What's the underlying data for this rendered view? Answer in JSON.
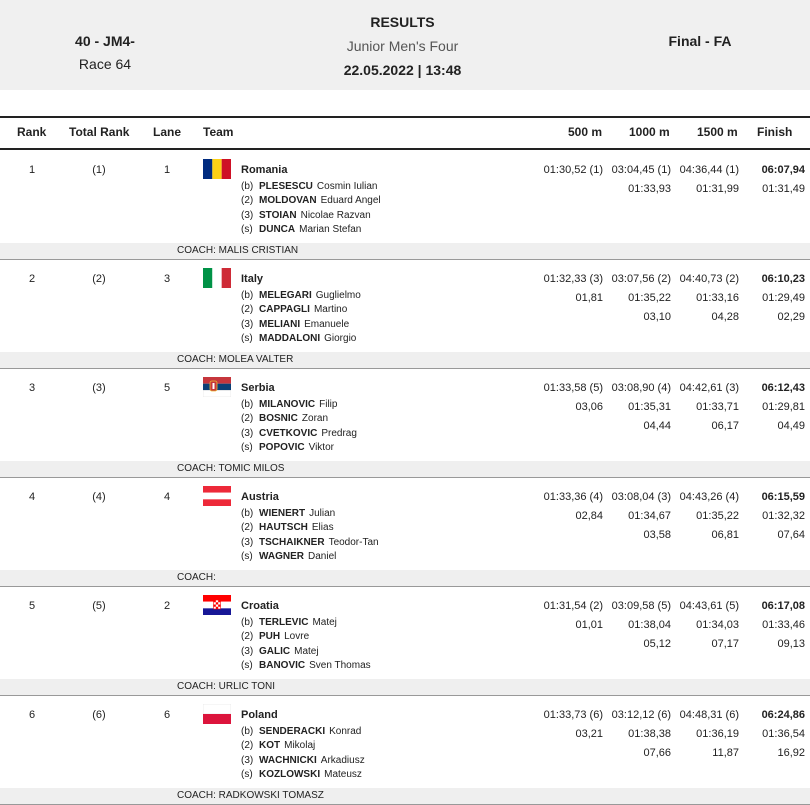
{
  "header": {
    "event_code": "40 - JM4-",
    "race": "Race 64",
    "title": "RESULTS",
    "event_name": "Junior Men's Four",
    "datetime": "22.05.2022 | 13:48",
    "final": "Final - FA"
  },
  "columns": [
    "Rank",
    "Total Rank",
    "Lane",
    "Team",
    "500 m",
    "1000 m",
    "1500 m",
    "Finish"
  ],
  "rows": [
    {
      "rank": "1",
      "trank": "(1)",
      "lane": "1",
      "country": "Romania",
      "flag": "romania-flag",
      "crew": [
        {
          "pos": "(b)",
          "sur": "PLESESCU",
          "given": "Cosmin Iulian"
        },
        {
          "pos": "(2)",
          "sur": "MOLDOVAN",
          "given": "Eduard Angel"
        },
        {
          "pos": "(3)",
          "sur": "STOIAN",
          "given": "Nicolae Razvan"
        },
        {
          "pos": "(s)",
          "sur": "DUNCA",
          "given": "Marian Stefan"
        }
      ],
      "t500": [
        "01:30,52 (1)",
        "",
        ""
      ],
      "t1000": [
        "03:04,45 (1)",
        "01:33,93",
        ""
      ],
      "t1500": [
        "04:36,44 (1)",
        "01:31,99",
        ""
      ],
      "fin": [
        "06:07,94",
        "01:31,49",
        ""
      ],
      "coach": "COACH: MALIS CRISTIAN"
    },
    {
      "rank": "2",
      "trank": "(2)",
      "lane": "3",
      "country": "Italy",
      "flag": "italy-flag",
      "crew": [
        {
          "pos": "(b)",
          "sur": "MELEGARI",
          "given": "Guglielmo"
        },
        {
          "pos": "(2)",
          "sur": "CAPPAGLI",
          "given": "Martino"
        },
        {
          "pos": "(3)",
          "sur": "MELIANI",
          "given": "Emanuele"
        },
        {
          "pos": "(s)",
          "sur": "MADDALONI",
          "given": "Giorgio"
        }
      ],
      "t500": [
        "01:32,33 (3)",
        "01,81",
        ""
      ],
      "t1000": [
        "03:07,56 (2)",
        "01:35,22",
        "03,10"
      ],
      "t1500": [
        "04:40,73 (2)",
        "01:33,16",
        "04,28"
      ],
      "fin": [
        "06:10,23",
        "01:29,49",
        "02,29"
      ],
      "coach": "COACH: MOLEA VALTER"
    },
    {
      "rank": "3",
      "trank": "(3)",
      "lane": "5",
      "country": "Serbia",
      "flag": "serbia-flag",
      "crew": [
        {
          "pos": "(b)",
          "sur": "MILANOVIC",
          "given": "Filip"
        },
        {
          "pos": "(2)",
          "sur": "BOSNIC",
          "given": "Zoran"
        },
        {
          "pos": "(3)",
          "sur": "CVETKOVIC",
          "given": "Predrag"
        },
        {
          "pos": "(s)",
          "sur": "POPOVIC",
          "given": "Viktor"
        }
      ],
      "t500": [
        "01:33,58 (5)",
        "03,06",
        ""
      ],
      "t1000": [
        "03:08,90 (4)",
        "01:35,31",
        "04,44"
      ],
      "t1500": [
        "04:42,61 (3)",
        "01:33,71",
        "06,17"
      ],
      "fin": [
        "06:12,43",
        "01:29,81",
        "04,49"
      ],
      "coach": "COACH: TOMIC MILOS"
    },
    {
      "rank": "4",
      "trank": "(4)",
      "lane": "4",
      "country": "Austria",
      "flag": "austria-flag",
      "crew": [
        {
          "pos": "(b)",
          "sur": "WIENERT",
          "given": "Julian"
        },
        {
          "pos": "(2)",
          "sur": "HAUTSCH",
          "given": "Elias"
        },
        {
          "pos": "(3)",
          "sur": "TSCHAIKNER",
          "given": "Teodor-Tan"
        },
        {
          "pos": "(s)",
          "sur": "WAGNER",
          "given": "Daniel"
        }
      ],
      "t500": [
        "01:33,36 (4)",
        "02,84",
        ""
      ],
      "t1000": [
        "03:08,04 (3)",
        "01:34,67",
        "03,58"
      ],
      "t1500": [
        "04:43,26 (4)",
        "01:35,22",
        "06,81"
      ],
      "fin": [
        "06:15,59",
        "01:32,32",
        "07,64"
      ],
      "coach": "COACH:"
    },
    {
      "rank": "5",
      "trank": "(5)",
      "lane": "2",
      "country": "Croatia",
      "flag": "croatia-flag",
      "crew": [
        {
          "pos": "(b)",
          "sur": "TERLEVIC",
          "given": "Matej"
        },
        {
          "pos": "(2)",
          "sur": "PUH",
          "given": "Lovre"
        },
        {
          "pos": "(3)",
          "sur": "GALIC",
          "given": "Matej"
        },
        {
          "pos": "(s)",
          "sur": "BANOVIC",
          "given": "Sven Thomas"
        }
      ],
      "t500": [
        "01:31,54 (2)",
        "01,01",
        ""
      ],
      "t1000": [
        "03:09,58 (5)",
        "01:38,04",
        "05,12"
      ],
      "t1500": [
        "04:43,61 (5)",
        "01:34,03",
        "07,17"
      ],
      "fin": [
        "06:17,08",
        "01:33,46",
        "09,13"
      ],
      "coach": "COACH: URLIC TONI"
    },
    {
      "rank": "6",
      "trank": "(6)",
      "lane": "6",
      "country": "Poland",
      "flag": "poland-flag",
      "crew": [
        {
          "pos": "(b)",
          "sur": "SENDERACKI",
          "given": "Konrad"
        },
        {
          "pos": "(2)",
          "sur": "KOT",
          "given": "Mikolaj"
        },
        {
          "pos": "(3)",
          "sur": "WACHNICKI",
          "given": "Arkadiusz"
        },
        {
          "pos": "(s)",
          "sur": "KOZLOWSKI",
          "given": "Mateusz"
        }
      ],
      "t500": [
        "01:33,73 (6)",
        "03,21",
        ""
      ],
      "t1000": [
        "03:12,12 (6)",
        "01:38,38",
        "07,66"
      ],
      "t1500": [
        "04:48,31 (6)",
        "01:36,19",
        "11,87"
      ],
      "fin": [
        "06:24,86",
        "01:36,54",
        "16,92"
      ],
      "coach": "COACH: RADKOWSKI TOMASZ"
    }
  ]
}
